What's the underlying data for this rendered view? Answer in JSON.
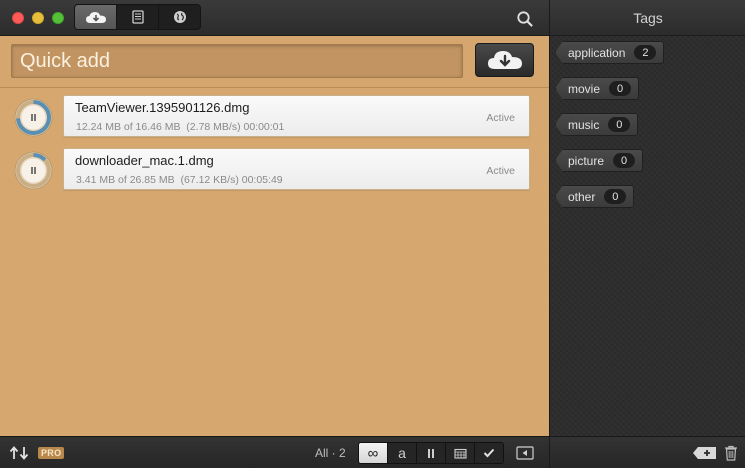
{
  "toolbar": {
    "tabs": [
      {
        "name": "downloads",
        "icon": "cloud-download-icon",
        "active": true
      },
      {
        "name": "log",
        "icon": "document-icon",
        "active": false
      },
      {
        "name": "browser",
        "icon": "globe-icon",
        "active": false
      }
    ],
    "search_icon": "search-icon"
  },
  "quick_add": {
    "placeholder": "Quick add",
    "value": "",
    "button_icon": "cloud-download-icon"
  },
  "downloads": [
    {
      "name": "TeamViewer.1395901126.dmg",
      "info": "12.24 MB of 16.46 MB  (2.78 MB/s) 00:00:01",
      "status": "Active",
      "progress": 0.74,
      "action_icon": "pause-icon"
    },
    {
      "name": "downloader_mac.1.dmg",
      "info": "3.41 MB of 26.85 MB  (67.12 KB/s) 00:05:49",
      "status": "Active",
      "progress": 0.13,
      "action_icon": "pause-icon"
    }
  ],
  "bottom_bar": {
    "sort_icon": "sort-arrows-icon",
    "pro_label": "PRO",
    "count_label": "All · 2",
    "filters": [
      {
        "name": "all",
        "glyph": "∞",
        "active": true
      },
      {
        "name": "active",
        "glyph": "a",
        "active": false
      },
      {
        "name": "paused",
        "glyph": "⏸",
        "active": false
      },
      {
        "name": "scheduled",
        "glyph": "calendar",
        "active": false
      },
      {
        "name": "completed",
        "glyph": "✓",
        "active": false
      }
    ],
    "collapse_icon": "collapse-sidebar-icon"
  },
  "sidebar": {
    "title": "Tags",
    "tags": [
      {
        "label": "application",
        "count": "2"
      },
      {
        "label": "movie",
        "count": "0"
      },
      {
        "label": "music",
        "count": "0"
      },
      {
        "label": "picture",
        "count": "0"
      },
      {
        "label": "other",
        "count": "0"
      }
    ],
    "add_icon": "add-tag-icon",
    "trash_icon": "trash-icon"
  },
  "colors": {
    "main_background": "#d6a870",
    "progress_ring": "#5a8fb4",
    "sidebar_background": "#2d2d2d",
    "pro_badge": "#b8874c"
  }
}
